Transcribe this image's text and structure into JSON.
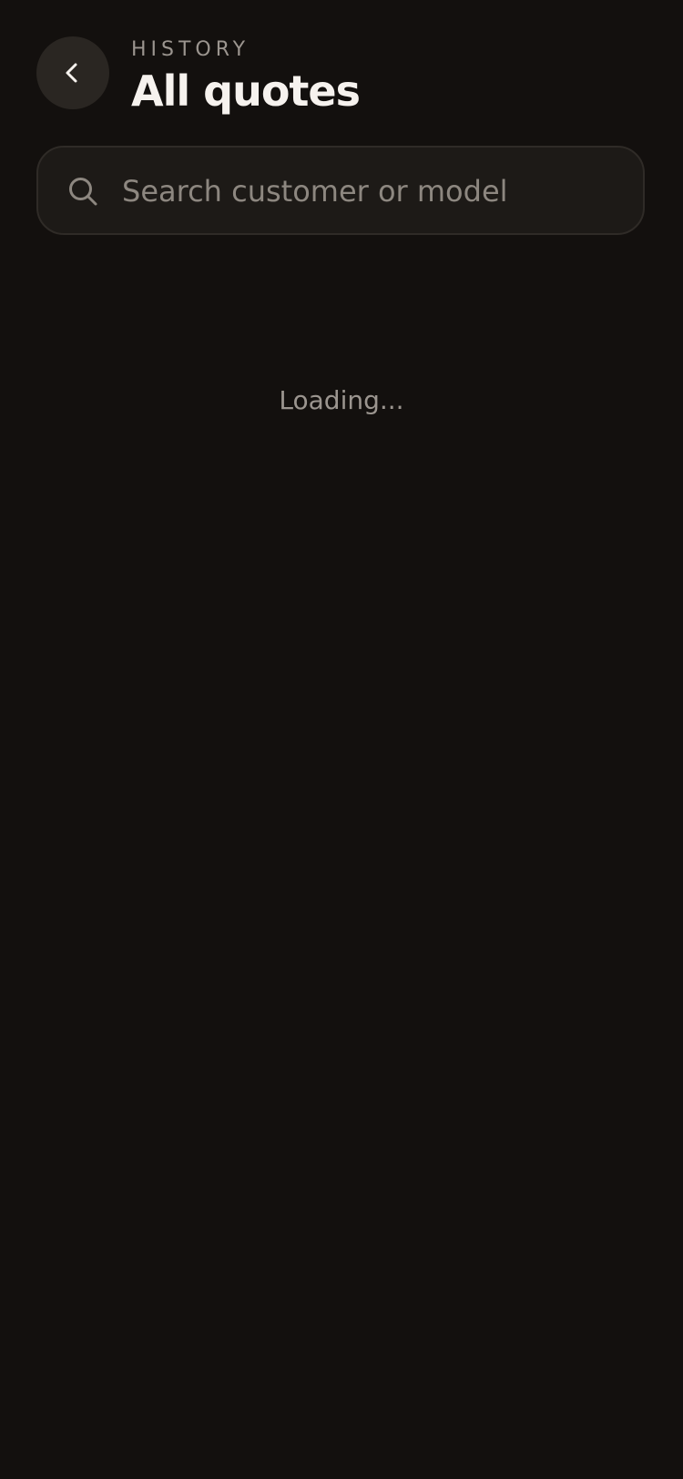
{
  "header": {
    "eyebrow": "HISTORY",
    "title": "All quotes",
    "back_icon": "chevron-left-icon"
  },
  "search": {
    "placeholder": "Search customer or model",
    "value": "",
    "icon": "search-icon"
  },
  "status": {
    "loading_text": "Loading..."
  },
  "colors": {
    "background": "#13100e",
    "button_bg": "#2a2622",
    "search_bg": "#1d1a17",
    "title": "#f6f2ee",
    "muted": "#9b958f"
  }
}
